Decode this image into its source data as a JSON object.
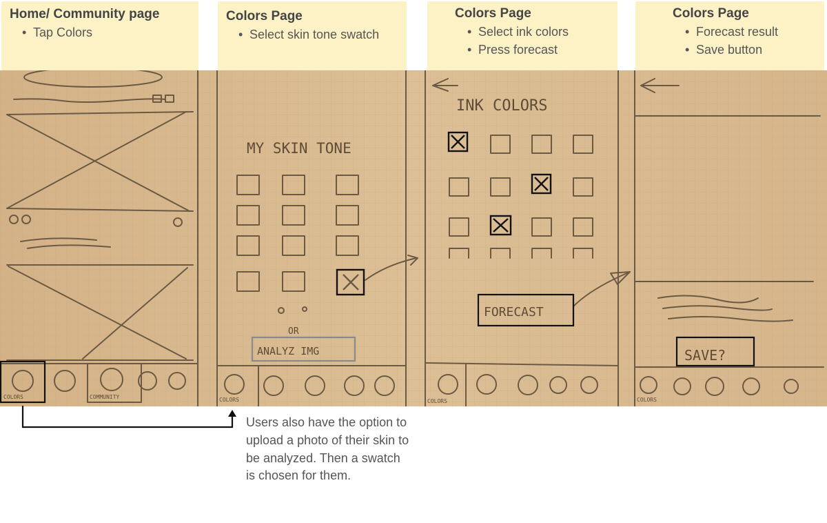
{
  "steps": [
    {
      "title": "Home/ Community page",
      "bullets": [
        "Tap Colors"
      ]
    },
    {
      "title": "Colors Page",
      "bullets": [
        "Select skin tone swatch"
      ]
    },
    {
      "title": "Colors Page",
      "bullets": [
        "Select ink colors",
        "Press forecast"
      ]
    },
    {
      "title": "Colors Page",
      "bullets": [
        "Forecast result",
        "Save button"
      ]
    }
  ],
  "sketch": {
    "skin_tone_heading": "MY SKIN TONE",
    "or_text": "OR",
    "analyze_button": "ANALYZ IMG",
    "ink_colors_heading": "INK COLORS",
    "forecast_button": "FORECAST",
    "save_button": "SAVE?",
    "tab_colors": "COLORS",
    "tab_community": "COMMUNITY"
  },
  "annotation": "Users also have the option to upload a photo of their skin to be analyzed. Then a swatch is chosen for them.",
  "colors": {
    "header_bg": "#fdf2c6",
    "paper": "#d9b98d",
    "pencil": "#6b5a43",
    "highlight_box": "#111111",
    "analyze_box": "#8a8a8a"
  }
}
